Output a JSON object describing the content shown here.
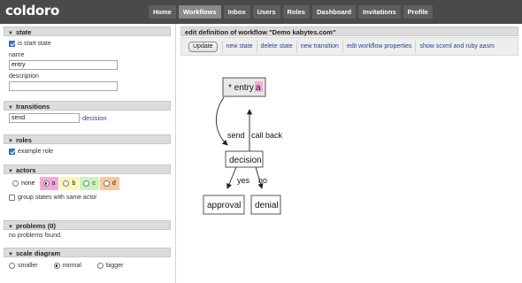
{
  "app": {
    "logo": "coldoro"
  },
  "nav": {
    "items": [
      "Home",
      "Workflows",
      "Inbox",
      "Users",
      "Roles",
      "Dashboard",
      "Invitations",
      "Profile"
    ],
    "active": "Workflows"
  },
  "state_panel": {
    "title": "state",
    "is_start_label": "is start state",
    "name_label": "name",
    "name_value": "entry",
    "description_label": "description",
    "description_value": ""
  },
  "transitions_panel": {
    "title": "transitions",
    "transition_value": "send",
    "target_link": "decision"
  },
  "roles_panel": {
    "title": "roles",
    "role_label": "example role"
  },
  "actors_panel": {
    "title": "actors",
    "options": [
      {
        "label": "none",
        "color": "#ffffff"
      },
      {
        "label": "a",
        "color": "#f7a8d8"
      },
      {
        "label": "b",
        "color": "#fbf7b5"
      },
      {
        "label": "c",
        "color": "#c8f5c0"
      },
      {
        "label": "d",
        "color": "#f8c99a"
      }
    ],
    "selected": "a",
    "group_label": "group states with same actor"
  },
  "problems_panel": {
    "title": "problems (0)",
    "message": "no problems found."
  },
  "scale_panel": {
    "title": "scale diagram",
    "options": [
      "smaller",
      "normal",
      "bigger"
    ],
    "selected": "normal"
  },
  "main": {
    "heading": "edit definition of workflow \"Demo kabytes.com\"",
    "toolbar": {
      "update_label": "Update",
      "links": [
        "new state",
        "delete state",
        "new transition",
        "edit workflow properties",
        "show scxml and ruby aasm"
      ]
    }
  },
  "diagram": {
    "states": {
      "entry": {
        "label": "* entry",
        "actor": "a"
      },
      "decision": {
        "label": "decision"
      },
      "approval": {
        "label": "approval"
      },
      "denial": {
        "label": "denial"
      }
    },
    "transitions": {
      "send": "send",
      "call_back": "call back",
      "yes": "yes",
      "no": "no"
    }
  }
}
